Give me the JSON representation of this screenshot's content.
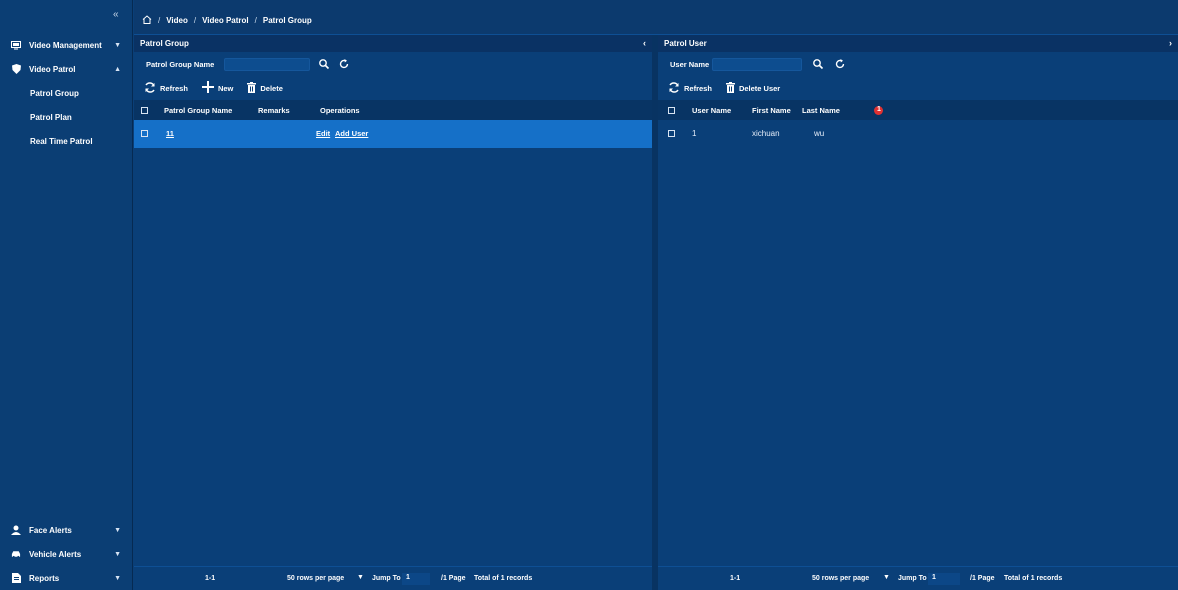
{
  "sidebar": {
    "collapse_label": "«",
    "items": [
      {
        "label": "Video Management",
        "icon": "monitor-icon"
      },
      {
        "label": "Video Patrol",
        "icon": "shield-icon"
      },
      {
        "label": "Face Alerts",
        "icon": "person-icon"
      },
      {
        "label": "Vehicle Alerts",
        "icon": "car-icon"
      },
      {
        "label": "Reports",
        "icon": "document-icon"
      }
    ],
    "sub_items": [
      "Patrol Group",
      "Patrol Plan",
      "Real Time Patrol"
    ]
  },
  "breadcrumb": {
    "home_icon": "home-icon",
    "sep": "/",
    "items": [
      "Video",
      "Video Patrol",
      "Patrol Group"
    ]
  },
  "left_panel": {
    "title": "Patrol Group",
    "search_label": "Patrol Group Name",
    "search_value": "",
    "toolbar": {
      "refresh": "Refresh",
      "new": "New",
      "delete": "Delete"
    },
    "columns": [
      "Patrol Group Name",
      "Remarks",
      "Operations"
    ],
    "rows": [
      {
        "name": "11",
        "remarks": "",
        "edit": "Edit",
        "add_user": "Add User"
      }
    ],
    "footer": {
      "range": "1-1",
      "rows_per_page": "50 rows per page",
      "jump_to": "Jump To",
      "page_value": "1",
      "pages": "/1 Page",
      "total": "Total of 1 records"
    }
  },
  "right_panel": {
    "title": "Patrol User",
    "search_label": "User Name",
    "search_value": "",
    "toolbar": {
      "refresh": "Refresh",
      "delete_user": "Delete User"
    },
    "columns": [
      "User Name",
      "First Name",
      "Last Name"
    ],
    "badge": "1",
    "rows": [
      {
        "user_name": "1",
        "first_name": "xichuan",
        "last_name": "wu"
      }
    ],
    "footer": {
      "range": "1-1",
      "rows_per_page": "50 rows per page",
      "jump_to": "Jump To",
      "page_value": "1",
      "pages": "/1 Page",
      "total": "Total of 1 records"
    }
  },
  "colors": {
    "background": "#0a3f78",
    "selected_row": "#1570c8",
    "badge": "#e03131"
  }
}
